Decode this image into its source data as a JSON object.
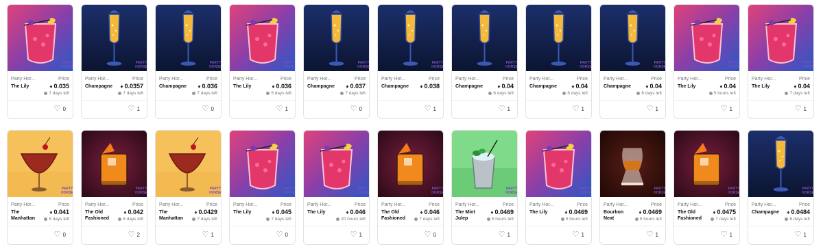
{
  "price_label": "Price",
  "row1": [
    {
      "art": "lily",
      "collection": "Party Hor...",
      "name": "The Lily",
      "price": "0.035",
      "time": "7 days left",
      "likes": "0"
    },
    {
      "art": "champagne",
      "collection": "Party Hor...",
      "name": "Champagne",
      "price": "0.0357",
      "time": "7 days left",
      "likes": "1"
    },
    {
      "art": "champagne",
      "collection": "Party Hor...",
      "name": "Champagne",
      "price": "0.036",
      "time": "7 days left",
      "likes": "0"
    },
    {
      "art": "lily",
      "collection": "Party Hor...",
      "name": "The Lily",
      "price": "0.036",
      "time": "5 days left",
      "likes": "1"
    },
    {
      "art": "champagne",
      "collection": "Party Hor...",
      "name": "Champagne",
      "price": "0.037",
      "time": "7 days left",
      "likes": "0"
    },
    {
      "art": "champagne",
      "collection": "Party Hor...",
      "name": "Champagne",
      "price": "0.038",
      "time": "",
      "likes": "1"
    },
    {
      "art": "champagne",
      "collection": "Party Hor...",
      "name": "Champagne",
      "price": "0.04",
      "time": "6 days left",
      "likes": "1"
    },
    {
      "art": "champagne",
      "collection": "Party Hor...",
      "name": "Champagne",
      "price": "0.04",
      "time": "6 days left",
      "likes": "1"
    },
    {
      "art": "champagne",
      "collection": "Party Hor...",
      "name": "Champagne",
      "price": "0.04",
      "time": "6 days left",
      "likes": "1"
    },
    {
      "art": "lily",
      "collection": "Party Hor...",
      "name": "The Lily",
      "price": "0.04",
      "time": "5 hours left",
      "likes": "1"
    },
    {
      "art": "lily",
      "collection": "Party Hor...",
      "name": "The Lily",
      "price": "0.04",
      "time": "7 days left",
      "likes": "1"
    }
  ],
  "row2": [
    {
      "art": "manhattan",
      "collection": "Party Hor...",
      "name": "The Manhattan",
      "price": "0.041",
      "time": "6 days left",
      "likes": "0"
    },
    {
      "art": "oldfashioned",
      "collection": "Party Hor...",
      "name": "The Old Fashioned",
      "price": "0.042",
      "time": "6 days left",
      "likes": "2"
    },
    {
      "art": "manhattan",
      "collection": "Party Hor...",
      "name": "The Manhattan",
      "price": "0.0429",
      "time": "7 days left",
      "likes": "1"
    },
    {
      "art": "lily",
      "collection": "Party Hor...",
      "name": "The Lily",
      "price": "0.045",
      "time": "7 days left",
      "likes": "0"
    },
    {
      "art": "lily",
      "collection": "Party Hor...",
      "name": "The Lily",
      "price": "0.046",
      "time": "20 hours left",
      "likes": "1"
    },
    {
      "art": "oldfashioned",
      "collection": "Party Hor...",
      "name": "The Old Fashioned",
      "price": "0.046",
      "time": "7 days left",
      "likes": "0"
    },
    {
      "art": "mintjulep",
      "collection": "Party Hor...",
      "name": "The Mint Julep",
      "price": "0.0469",
      "time": "5 hours left",
      "likes": "1"
    },
    {
      "art": "lily",
      "collection": "Party Hor...",
      "name": "The Lily",
      "price": "0.0469",
      "time": "5 hours left",
      "likes": "1"
    },
    {
      "art": "bourbon",
      "collection": "Party Hor...",
      "name": "Bourbon Neat",
      "price": "0.0469",
      "time": "5 hours left",
      "likes": "1"
    },
    {
      "art": "oldfashioned",
      "collection": "Party Hor...",
      "name": "The Old Fashioned",
      "price": "0.0475",
      "time": "7 days left",
      "likes": "1"
    },
    {
      "art": "champagne",
      "collection": "Party Hor...",
      "name": "Champagne",
      "price": "0.0484",
      "time": "6 days left",
      "likes": "1"
    }
  ]
}
